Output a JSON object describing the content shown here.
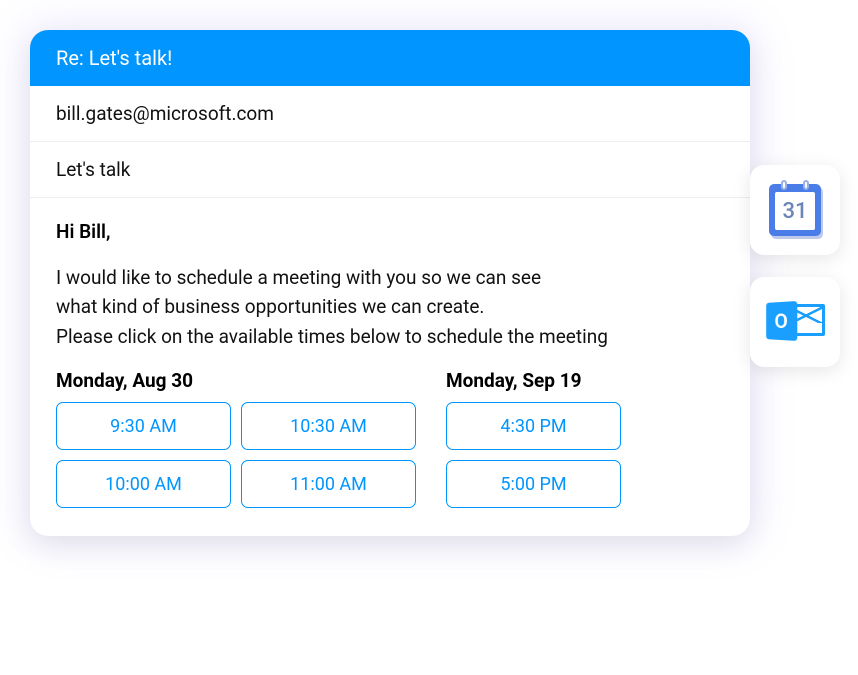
{
  "header": {
    "subject_prefixed": "Re: Let's talk!"
  },
  "fields": {
    "to": "bill.gates@microsoft.com",
    "subject": "Let's talk"
  },
  "body": {
    "greeting": "Hi Bill,",
    "line1": "I would like to schedule a meeting with you so we can see",
    "line2": "what kind of business opportunities we can create.",
    "line3": "Please click on the available times below to schedule the meeting"
  },
  "slots": [
    {
      "date": "Monday, Aug 30",
      "times": [
        "9:30 AM",
        "10:30 AM",
        "10:00 AM",
        "11:00 AM"
      ]
    },
    {
      "date": "Monday, Sep 19",
      "times": [
        "4:30 PM",
        "5:00 PM"
      ]
    }
  ],
  "icons": {
    "calendar_day": "31",
    "outlook_letter": "O"
  }
}
